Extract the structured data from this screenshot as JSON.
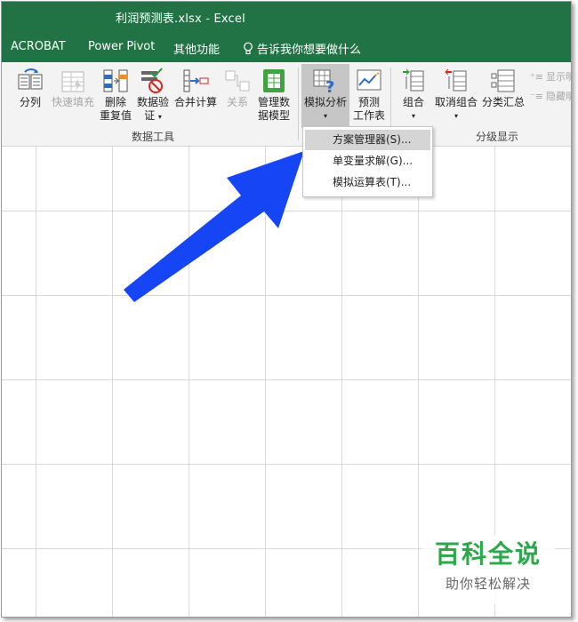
{
  "window": {
    "title": "利润预测表.xlsx  -  Excel"
  },
  "tabs": [
    "ACROBAT",
    "Power Pivot",
    "其他功能"
  ],
  "tell_me": "告诉我你想要做什么",
  "ribbon": {
    "data_tools": {
      "label": "数据工具",
      "split": "分列",
      "flash_fill": "快速填充",
      "remove_dup": [
        "删除",
        "重复值"
      ],
      "validation": [
        "数据验",
        "证"
      ],
      "consolidate": "合并计算",
      "relationships": "关系",
      "data_model": [
        "管理数",
        "据模型"
      ]
    },
    "forecast": {
      "what_if": "模拟分析",
      "forecast_sheet": [
        "预测",
        "工作表"
      ]
    },
    "outline": {
      "label": "分级显示",
      "group": "组合",
      "ungroup": "取消组合",
      "subtotal": "分类汇总",
      "show_detail": "显示明",
      "hide_detail": "隐藏明"
    }
  },
  "whatif_menu": {
    "items": [
      "方案管理器(S)...",
      "单变量求解(G)...",
      "模拟运算表(T)..."
    ],
    "highlighted": 0
  },
  "watermark": {
    "brand": "百科全说",
    "slogan": "助你轻松解决"
  },
  "colors": {
    "excel_green": "#217346",
    "arrow_blue": "#1645f5",
    "brand_green": "#2aa84a"
  }
}
